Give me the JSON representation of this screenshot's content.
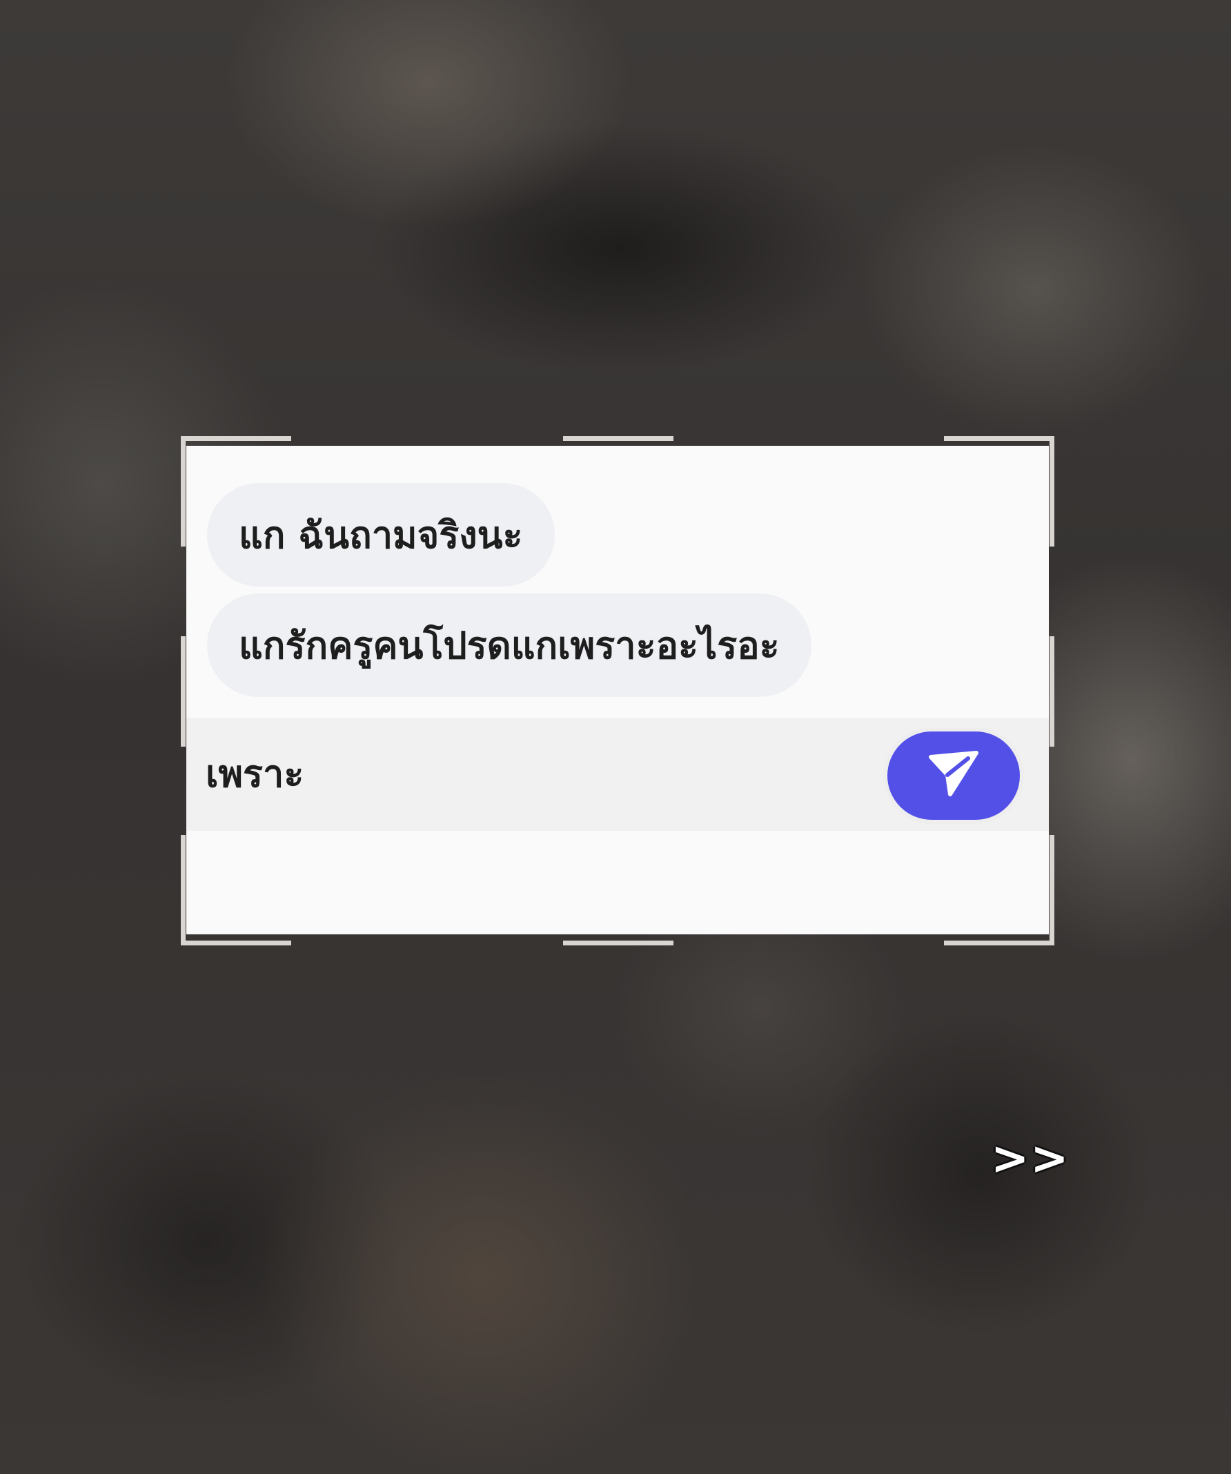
{
  "chat": {
    "messages": [
      {
        "text": "แก ฉันถามจริงนะ"
      },
      {
        "text": "แกรักครูคนโปรดแกเพราะอะไรอะ"
      }
    ]
  },
  "composer": {
    "value": "เพราะ",
    "send_icon": "send-icon",
    "accent_color": "#5350e8"
  },
  "overlay": {
    "next_label": ">>"
  }
}
